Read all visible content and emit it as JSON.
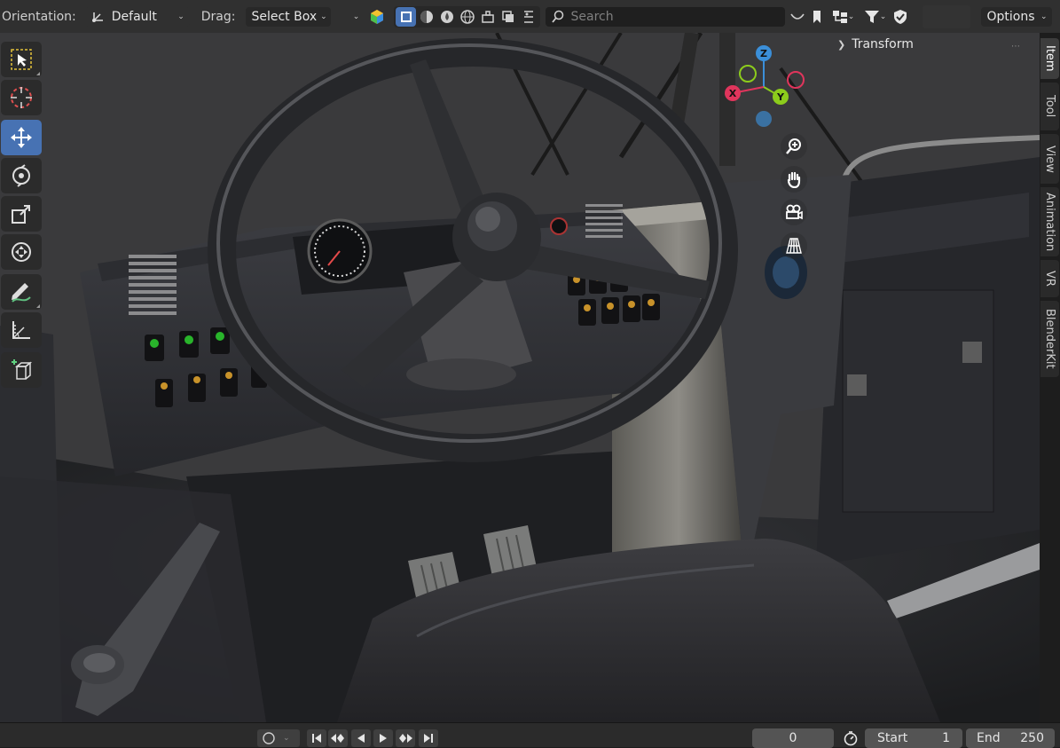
{
  "header": {
    "orientation_label": "Orientation:",
    "orientation_value": "Default",
    "drag_label": "Drag:",
    "drag_value": "Select Box",
    "search_placeholder": "Search",
    "options_label": "Options"
  },
  "viewport": {
    "sidebar_panel_title": "Transform",
    "gizmo_axes": [
      "X",
      "Y",
      "Z"
    ],
    "axis_colors": {
      "x": "#e0355c",
      "y": "#8ccc1c",
      "z": "#3b8fd9"
    },
    "accent_color": "#4772b3"
  },
  "toolbar": {
    "tools": [
      "select-box",
      "cursor",
      "move",
      "rotate",
      "scale",
      "transform",
      "annotate",
      "measure",
      "add-cube"
    ],
    "active_tool": "move"
  },
  "sidebar_tabs": [
    "Item",
    "Tool",
    "View",
    "Animation",
    "VR",
    "BlenderKit"
  ],
  "active_sidebar_tab": "Item",
  "timeline": {
    "current_frame": "0",
    "start_label": "Start",
    "start_value": "1",
    "end_label": "End",
    "end_value": "250"
  }
}
